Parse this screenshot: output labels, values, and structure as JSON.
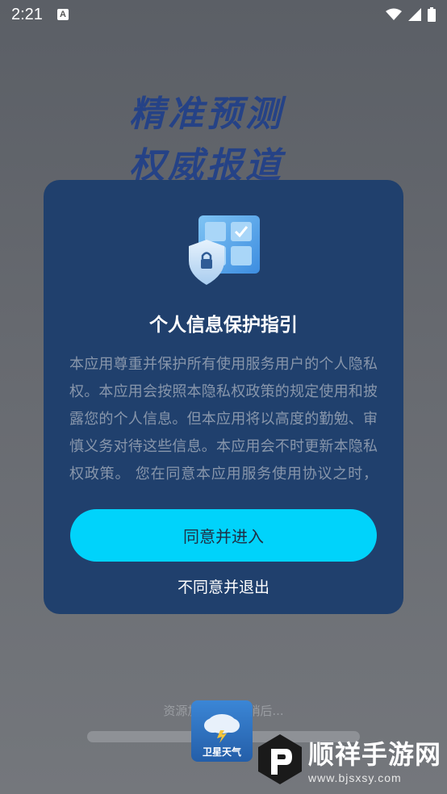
{
  "status_bar": {
    "time": "2:21",
    "notification_icon": "a-notification-icon",
    "wifi_icon": "wifi-icon",
    "signal_icon": "signal-icon",
    "battery_icon": "battery-icon"
  },
  "splash": {
    "slogan_line1": "精准预测",
    "slogan_line2": "权威报道",
    "loading_text": "资源加载中，请稍后...",
    "app_icon_label": "卫星天气"
  },
  "watermark": {
    "title": "顺祥手游网",
    "url": "www.bjsxsy.com"
  },
  "dialog": {
    "illustration_icon": "privacy-shield-icon",
    "title": "个人信息保护指引",
    "body": "本应用尊重并保护所有使用服务用户的个人隐私权。本应用会按照本隐私权政策的规定使用和披露您的个人信息。但本应用将以高度的勤勉、审慎义务对待这些信息。本应用会不时更新本隐私权政策。 您在同意本应用服务使用协议之时，即视为您已经同意本隐私权政策全部内容。",
    "agree_label": "同意并进入",
    "disagree_label": "不同意并退出"
  },
  "colors": {
    "dialog_bg": "#20406d",
    "accent": "#00d3fb",
    "body_text": "#8896ab"
  }
}
